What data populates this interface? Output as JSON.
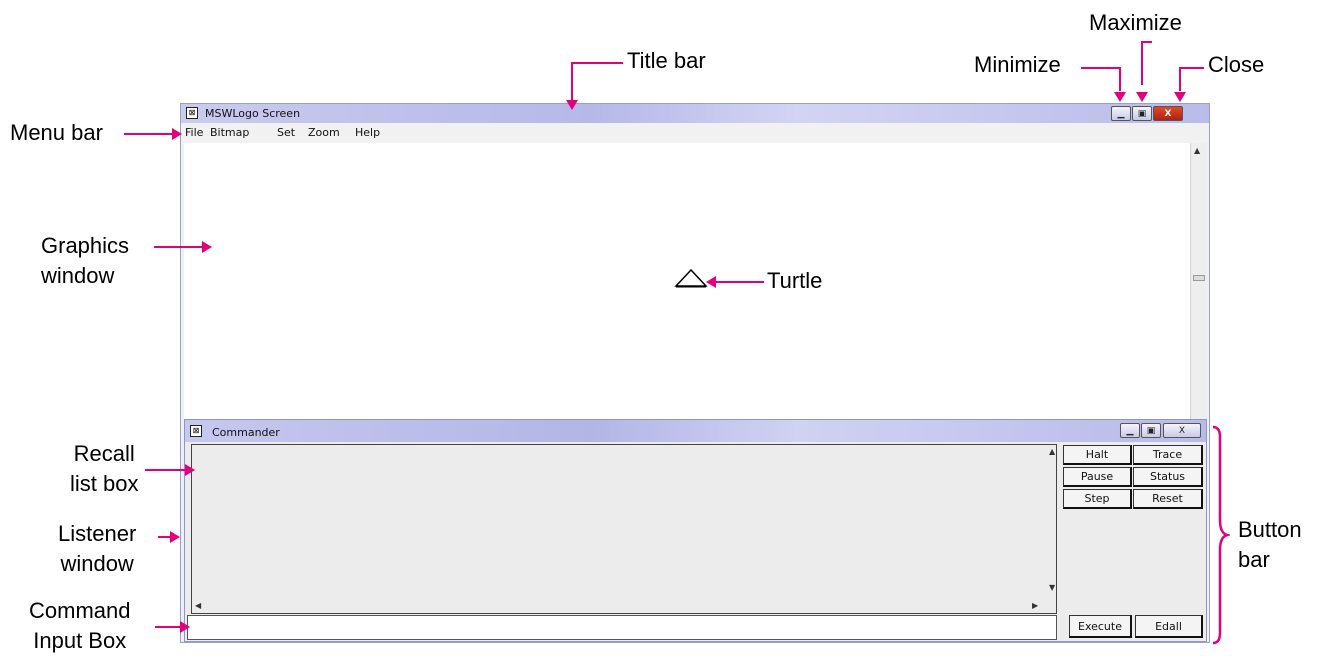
{
  "window": {
    "title": "MSWLogo Screen",
    "icon": "logo-app-icon",
    "controls": [
      "minimize-icon",
      "maximize-icon",
      "close-icon"
    ],
    "close_glyph": "X"
  },
  "menubar": {
    "items": [
      "File",
      "Bitmap",
      "Set",
      "Zoom",
      "Help"
    ]
  },
  "commander": {
    "title": "Commander",
    "close_glyph": "X",
    "buttons": [
      "Halt",
      "Trace",
      "Pause",
      "Status",
      "Step",
      "Reset"
    ],
    "execute_label": "Execute",
    "edall_label": "Edall"
  },
  "annotations": {
    "title_bar": "Title bar",
    "maximize": "Maximize",
    "minimize": "Minimize",
    "close": "Close",
    "menu_bar": "Menu bar",
    "graphics_window": "Graphics\nwindow",
    "turtle": "Turtle",
    "recall_list_box": "Recall\nlist box",
    "listener_window": "Listener\nwindow",
    "command_input_box": "Command\nInput Box",
    "button_bar": "Button\nbar"
  },
  "colors": {
    "annotation_accent": "#e4007c",
    "titlebar": "#b6b8e8",
    "close_button": "#c8301a"
  }
}
